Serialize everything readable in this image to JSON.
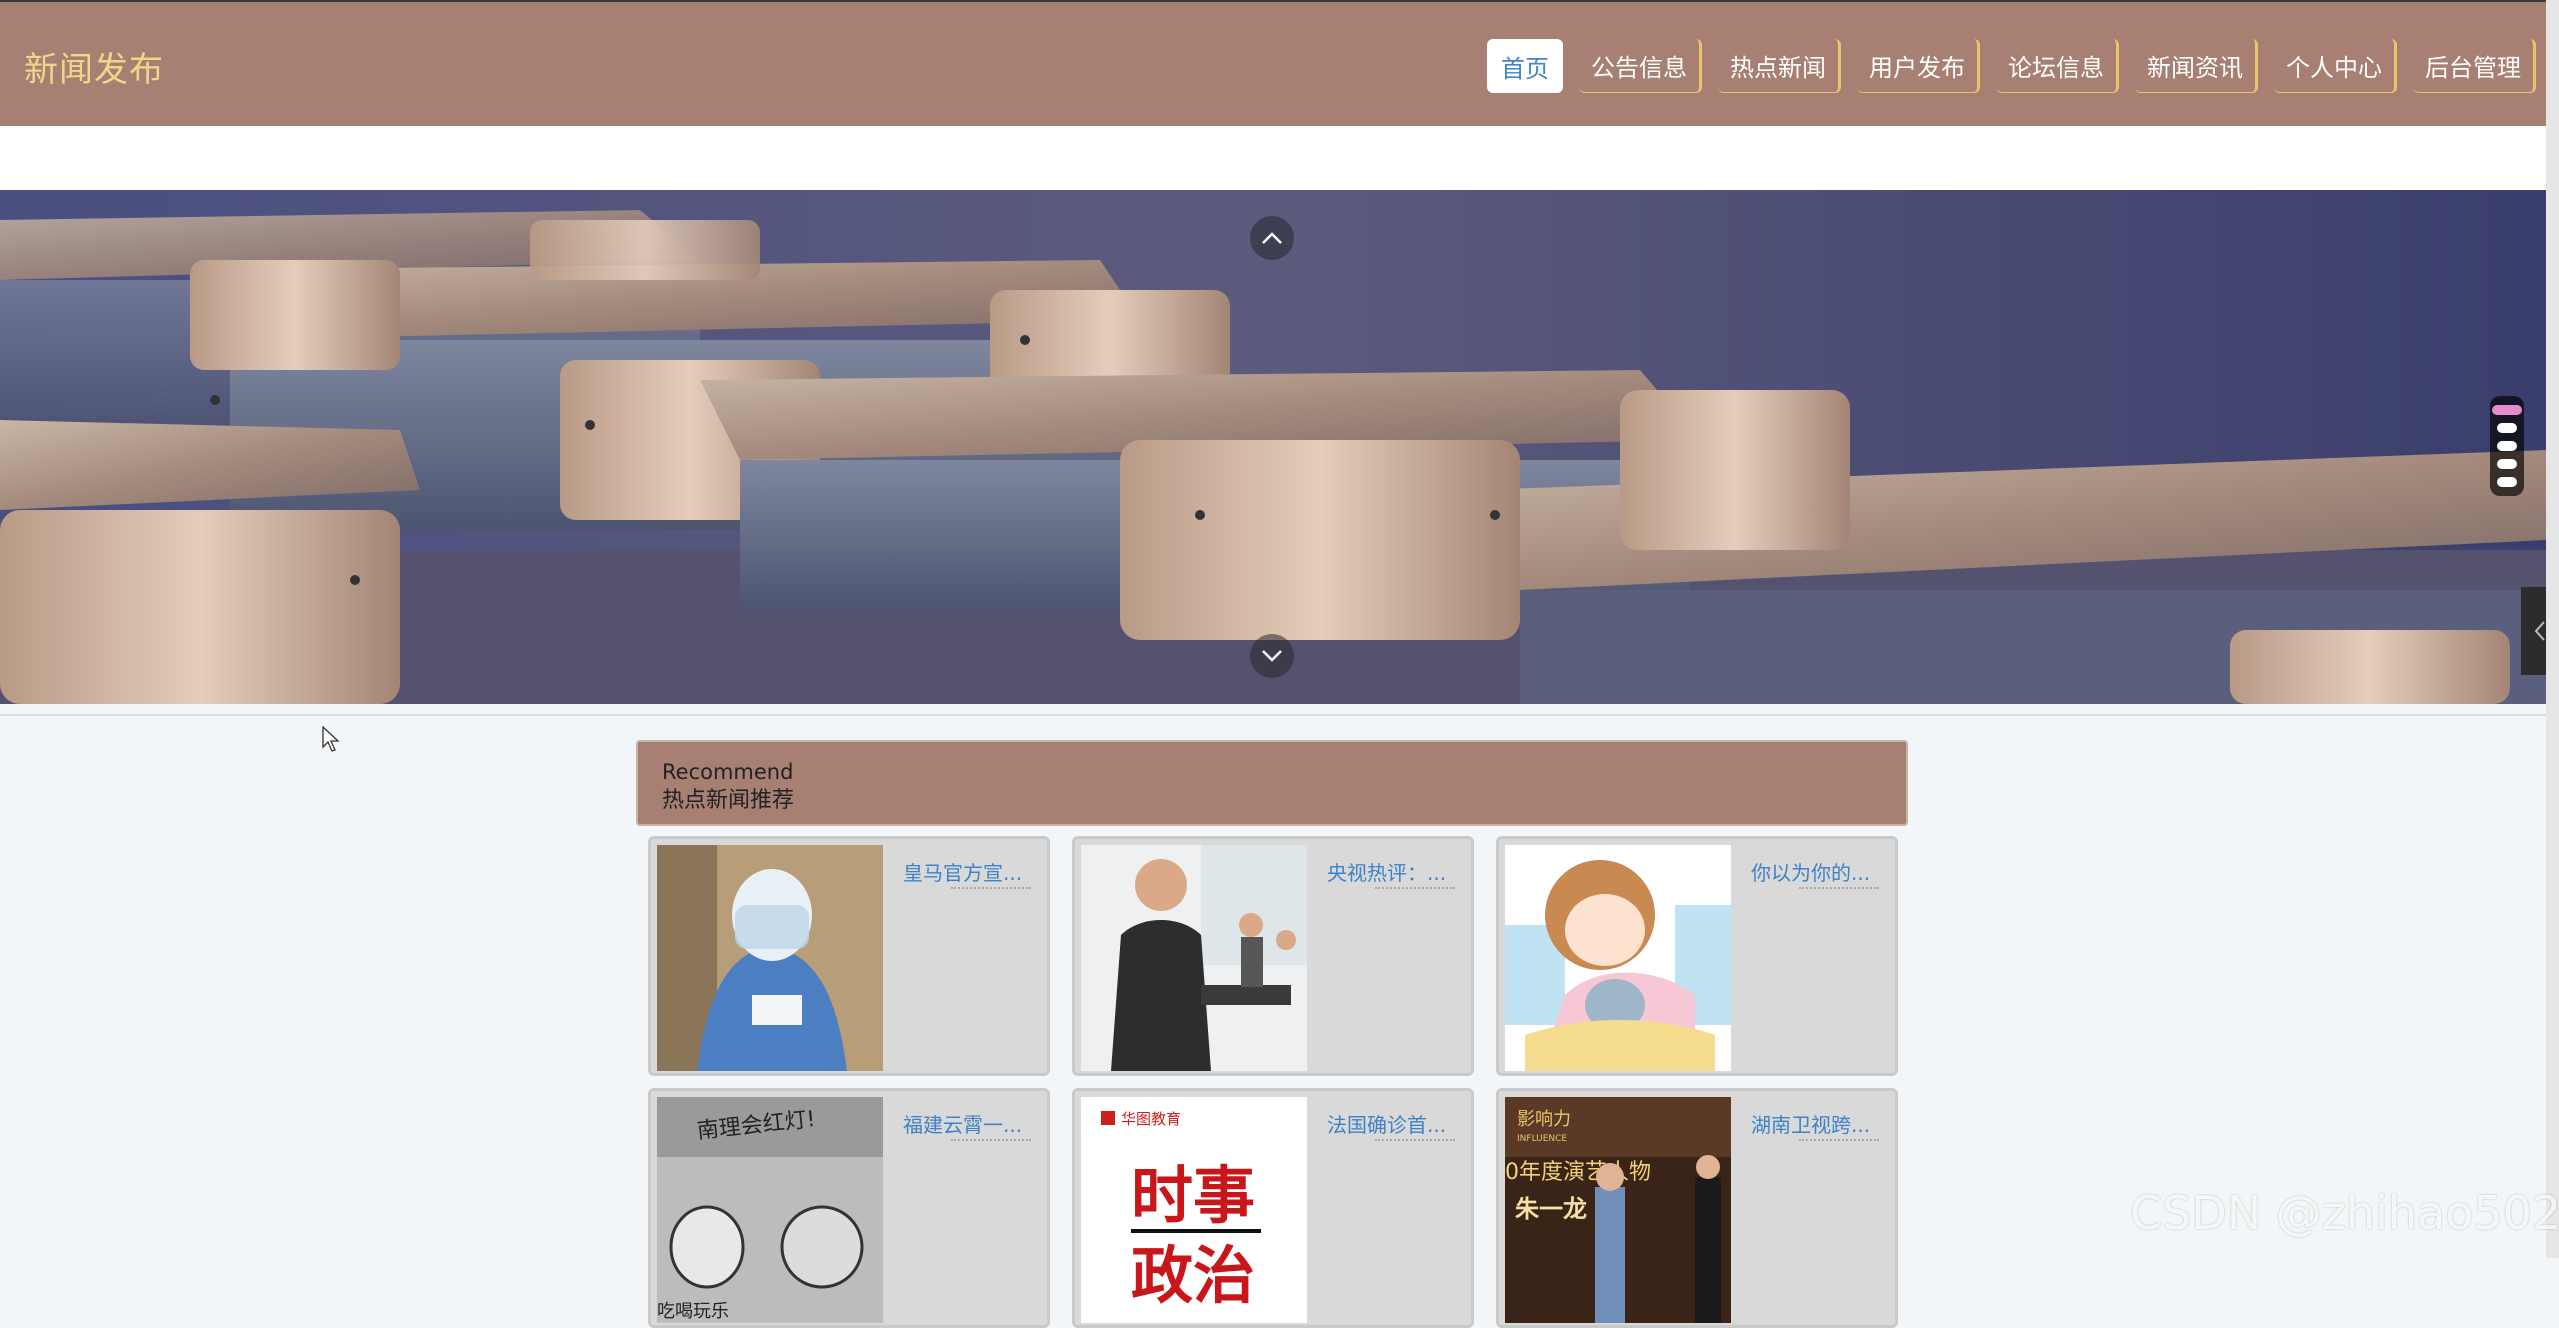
{
  "header": {
    "brand": "新闻发布",
    "nav": [
      {
        "label": "首页",
        "active": true
      },
      {
        "label": "公告信息"
      },
      {
        "label": "热点新闻"
      },
      {
        "label": "用户发布"
      },
      {
        "label": "论坛信息"
      },
      {
        "label": "新闻资讯"
      },
      {
        "label": "个人中心"
      },
      {
        "label": "后台管理"
      }
    ]
  },
  "carousel": {
    "slide_count": 5,
    "active_index": 0,
    "prev_icon": "chevron-up-icon",
    "next_icon": "chevron-down-icon"
  },
  "recommend": {
    "title_en": "Recommend",
    "title_zh": "热点新闻推荐",
    "cards": [
      {
        "title": "皇马官方宣..."
      },
      {
        "title": "央视热评：..."
      },
      {
        "title": "你以为你的..."
      },
      {
        "title": "福建云霄一..."
      },
      {
        "title": "法国确诊首..."
      },
      {
        "title": "湖南卫视跨..."
      }
    ],
    "thumb_texts": {
      "card4": "南理会红灯!",
      "card4_bottom": "吃喝玩乐",
      "card5_brand": "华图教育",
      "card5_big1": "时事",
      "card5_big2": "政治",
      "card6_brand": "影响力",
      "card6_brand_en": "INFLUENCE",
      "card6_line1": "0年度演艺人物",
      "card6_line2": "朱一龙"
    }
  },
  "colors": {
    "header_bg": "#a77f73",
    "brand": "#f3d48a",
    "link": "#3e82c6",
    "active_dot": "#e58cc9"
  },
  "watermark": "CSDN @zhihao502"
}
